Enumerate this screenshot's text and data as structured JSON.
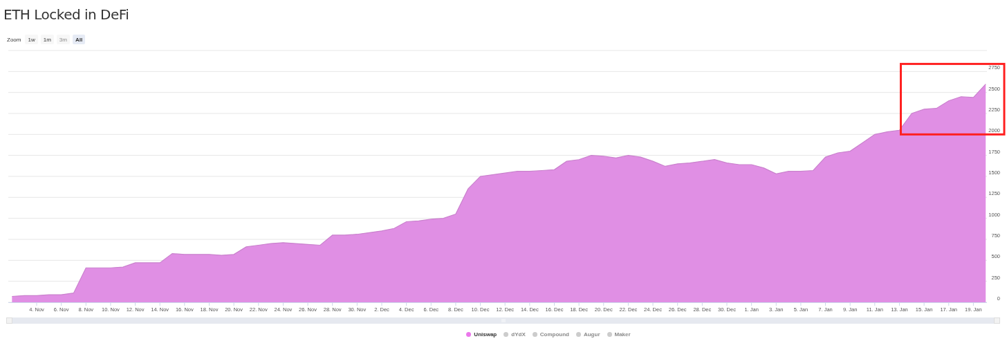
{
  "title": "ETH Locked in DeFi",
  "zoom": {
    "label": "Zoom",
    "buttons": [
      {
        "label": "1w",
        "selected": false,
        "disabled": false
      },
      {
        "label": "1m",
        "selected": false,
        "disabled": false
      },
      {
        "label": "3m",
        "selected": false,
        "disabled": true
      },
      {
        "label": "All",
        "selected": true,
        "disabled": false
      }
    ]
  },
  "chart": {
    "highlight": {
      "shown": true,
      "color": "#ff2020"
    },
    "chart_data": {
      "type": "area",
      "categories": [
        null,
        null,
        "4. Nov",
        null,
        "6. Nov",
        null,
        "8. Nov",
        null,
        "10. Nov",
        null,
        "12. Nov",
        null,
        "14. Nov",
        null,
        "16. Nov",
        null,
        "18. Nov",
        null,
        "20. Nov",
        null,
        "22. Nov",
        null,
        "24. Nov",
        null,
        "26. Nov",
        null,
        "28. Nov",
        null,
        "30. Nov",
        null,
        "2. Dec",
        null,
        "4. Dec",
        null,
        "6. Dec",
        null,
        "8. Dec",
        null,
        "10. Dec",
        null,
        "12. Dec",
        null,
        "14. Dec",
        null,
        "16. Dec",
        null,
        "18. Dec",
        null,
        "20. Dec",
        null,
        "22. Dec",
        null,
        "24. Dec",
        null,
        "26. Dec",
        null,
        "28. Dec",
        null,
        "30. Dec",
        null,
        "1. Jan",
        null,
        "3. Jan",
        null,
        "5. Jan",
        null,
        "7. Jan",
        null,
        "9. Jan",
        null,
        "11. Jan",
        null,
        "13. Jan",
        null,
        "15. Jan",
        null,
        "17. Jan",
        null,
        "19. Jan",
        null
      ],
      "series": [
        {
          "name": "Uniswap",
          "color": "#e08fe4",
          "values": [
            70,
            80,
            80,
            90,
            90,
            110,
            410,
            410,
            410,
            420,
            470,
            470,
            470,
            580,
            570,
            570,
            570,
            560,
            570,
            660,
            680,
            700,
            710,
            700,
            690,
            680,
            800,
            800,
            810,
            830,
            850,
            880,
            960,
            970,
            990,
            1000,
            1050,
            1350,
            1500,
            1520,
            1540,
            1560,
            1560,
            1570,
            1580,
            1680,
            1700,
            1750,
            1740,
            1720,
            1750,
            1730,
            1680,
            1620,
            1650,
            1660,
            1680,
            1700,
            1660,
            1640,
            1640,
            1600,
            1530,
            1560,
            1560,
            1570,
            1730,
            1780,
            1800,
            1900,
            2000,
            2030,
            2050,
            2250,
            2300,
            2310,
            2400,
            2450,
            2440,
            2600
          ]
        }
      ],
      "ylim": [
        0,
        3000
      ],
      "grid": true,
      "yticks": [
        0,
        250,
        500,
        750,
        1000,
        1250,
        1500,
        1750,
        2000,
        2250,
        2500,
        2750
      ]
    }
  },
  "legend": [
    {
      "name": "dYdX",
      "color": "#cccccc",
      "visible": false
    },
    {
      "name": "Compound",
      "color": "#cccccc",
      "visible": false
    },
    {
      "name": "Augur",
      "color": "#cccccc",
      "visible": false
    },
    {
      "name": "Maker",
      "color": "#cccccc",
      "visible": false
    }
  ]
}
